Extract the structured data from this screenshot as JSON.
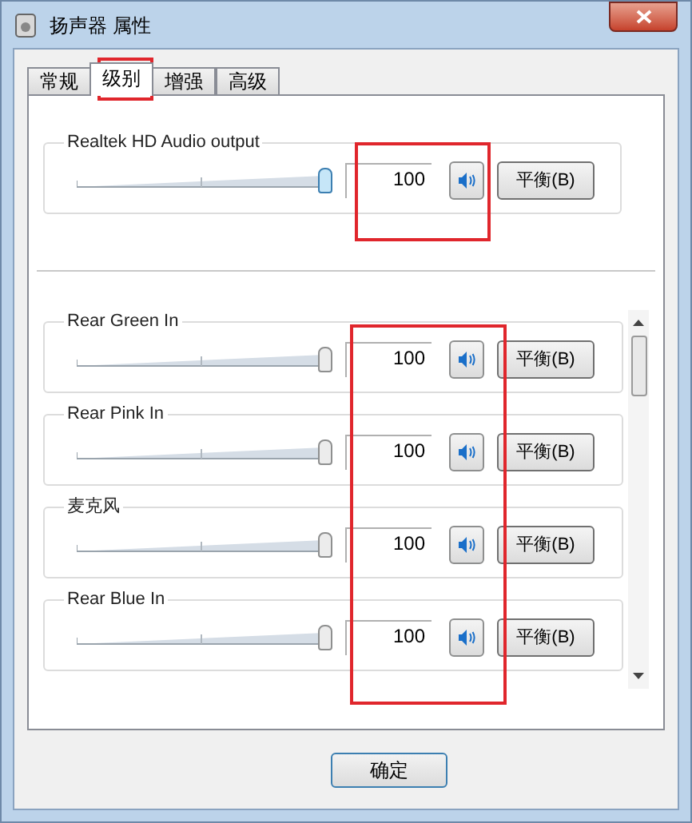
{
  "window": {
    "title": "扬声器 属性"
  },
  "tabs": [
    {
      "label": "常规",
      "selected": false
    },
    {
      "label": "级别",
      "selected": true
    },
    {
      "label": "增强",
      "selected": false
    },
    {
      "label": "高级",
      "selected": false
    }
  ],
  "master": {
    "name": "Realtek HD Audio output",
    "level": 1,
    "value": "100",
    "muted": false,
    "focused": true,
    "balance": "平衡(B)"
  },
  "channels": [
    {
      "name": "Rear Green In",
      "level": 1,
      "value": "100",
      "muted": false,
      "focused": false,
      "balance": "平衡(B)"
    },
    {
      "name": "Rear Pink In",
      "level": 1,
      "value": "100",
      "muted": false,
      "focused": false,
      "balance": "平衡(B)"
    },
    {
      "name": "麦克风",
      "level": 1,
      "value": "100",
      "muted": false,
      "focused": false,
      "balance": "平衡(B)"
    },
    {
      "name": "Rear Blue In",
      "level": 1,
      "value": "100",
      "muted": false,
      "focused": false,
      "balance": "平衡(B)"
    }
  ],
  "buttons": [
    "确定"
  ]
}
